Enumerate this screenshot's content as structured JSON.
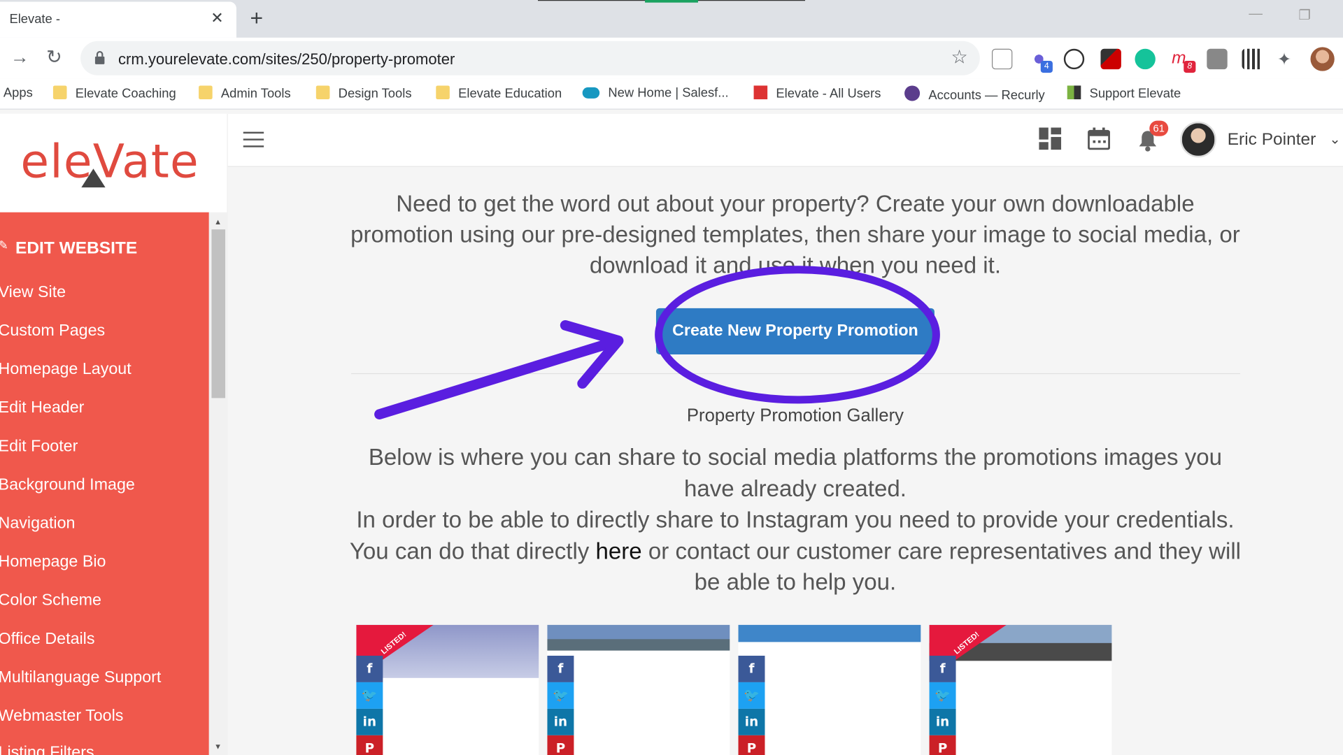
{
  "browser": {
    "tab_title": "Elevate -",
    "tab_close": "✕",
    "new_tab": "+",
    "url": "crm.yourelevate.com/sites/250/property-promoter",
    "extension_badges": {
      "ext_a": "4",
      "ext_b": "8"
    },
    "bookmarks": [
      "Apps",
      "Elevate Coaching",
      "Admin Tools",
      "Design Tools",
      "Elevate Education",
      "New Home | Salesf...",
      "Elevate - All Users",
      "Accounts — Recurly",
      "Support Elevate"
    ]
  },
  "header": {
    "logo": "eleVate",
    "notification_count": "61",
    "user_name": "Eric Pointer"
  },
  "sidebar": {
    "title": "EDIT WEBSITE",
    "items": [
      "View Site",
      "Custom Pages",
      "Homepage Layout",
      "Edit Header",
      "Edit Footer",
      "Background Image",
      "Navigation",
      "Homepage Bio",
      "Color Scheme",
      "Office Details",
      "Multilanguage Support",
      "Webmaster Tools",
      "Listing Filters"
    ]
  },
  "main": {
    "intro": "Need to get the word out about your property? Create your own downloadable promotion using our pre-designed templates, then share your image to social media, or download it and use it when you need it.",
    "create_button": "Create New Property Promotion",
    "gallery_title": "Property Promotion Gallery",
    "gallery_text_1": "Below is where you can share to social media platforms the promotions images you have already created.",
    "gallery_text_2a": "In order to be able to directly share to Instagram you need to provide your credentials. You can do that directly ",
    "gallery_link": "here",
    "gallery_text_2b": " or contact our customer care representatives and they will be able to help you.",
    "listed_label": "LISTED!",
    "social_icons": {
      "facebook": "f",
      "twitter": "🐦",
      "linkedin": "in",
      "pinterest": "P"
    }
  },
  "colors": {
    "sidebar": "#f0584c",
    "button": "#2e7bc4",
    "annotation": "#5a1ee0",
    "logo": "#e04a3f"
  }
}
